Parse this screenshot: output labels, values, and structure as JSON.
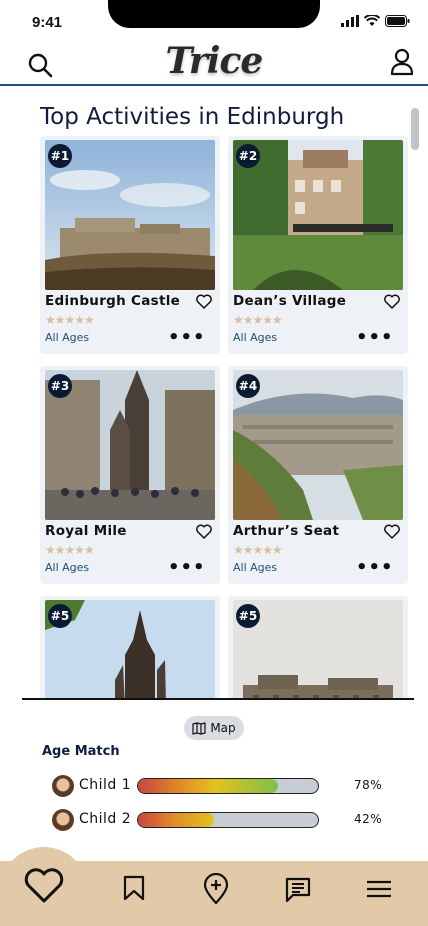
{
  "status": {
    "time": "9:41"
  },
  "app": {
    "logo": "Trice"
  },
  "page": {
    "title": "Top Activities in Edinburgh"
  },
  "cards": [
    {
      "rank": "#1",
      "name": "Edinburgh Castle",
      "ages": "All Ages",
      "rating": 4.5,
      "photo": "edinburgh-castle"
    },
    {
      "rank": "#2",
      "name": "Dean’s Village",
      "ages": "All Ages",
      "rating": 4.5,
      "photo": "deans-village"
    },
    {
      "rank": "#3",
      "name": "Royal Mile",
      "ages": "All Ages",
      "rating": 4.5,
      "photo": "royal-mile"
    },
    {
      "rank": "#4",
      "name": "Arthur’s Seat",
      "ages": "All Ages",
      "rating": 4.5,
      "photo": "arthurs-seat"
    },
    {
      "rank": "#5",
      "name": "",
      "ages": "",
      "photo": "scott-monument"
    },
    {
      "rank": "#5",
      "name": "",
      "ages": "",
      "photo": "stone-building"
    }
  ],
  "map_button": {
    "label": "Map"
  },
  "age_match": {
    "title": "Age Match",
    "children": [
      {
        "name": "Child 1",
        "percent_label": "78%",
        "fraction": 0.78
      },
      {
        "name": "Child 2",
        "percent_label": "42%",
        "fraction": 0.42
      }
    ]
  },
  "nav": {
    "items": [
      "heart-icon",
      "bookmark-icon",
      "add-location-icon",
      "messages-icon",
      "menu-icon"
    ],
    "active": "heart-icon"
  },
  "colors": {
    "accent": "#1f4e79",
    "nav_bg": "#e2c9a7",
    "card_bg": "#eef1f6",
    "rank_badge": "#0b1a33"
  }
}
